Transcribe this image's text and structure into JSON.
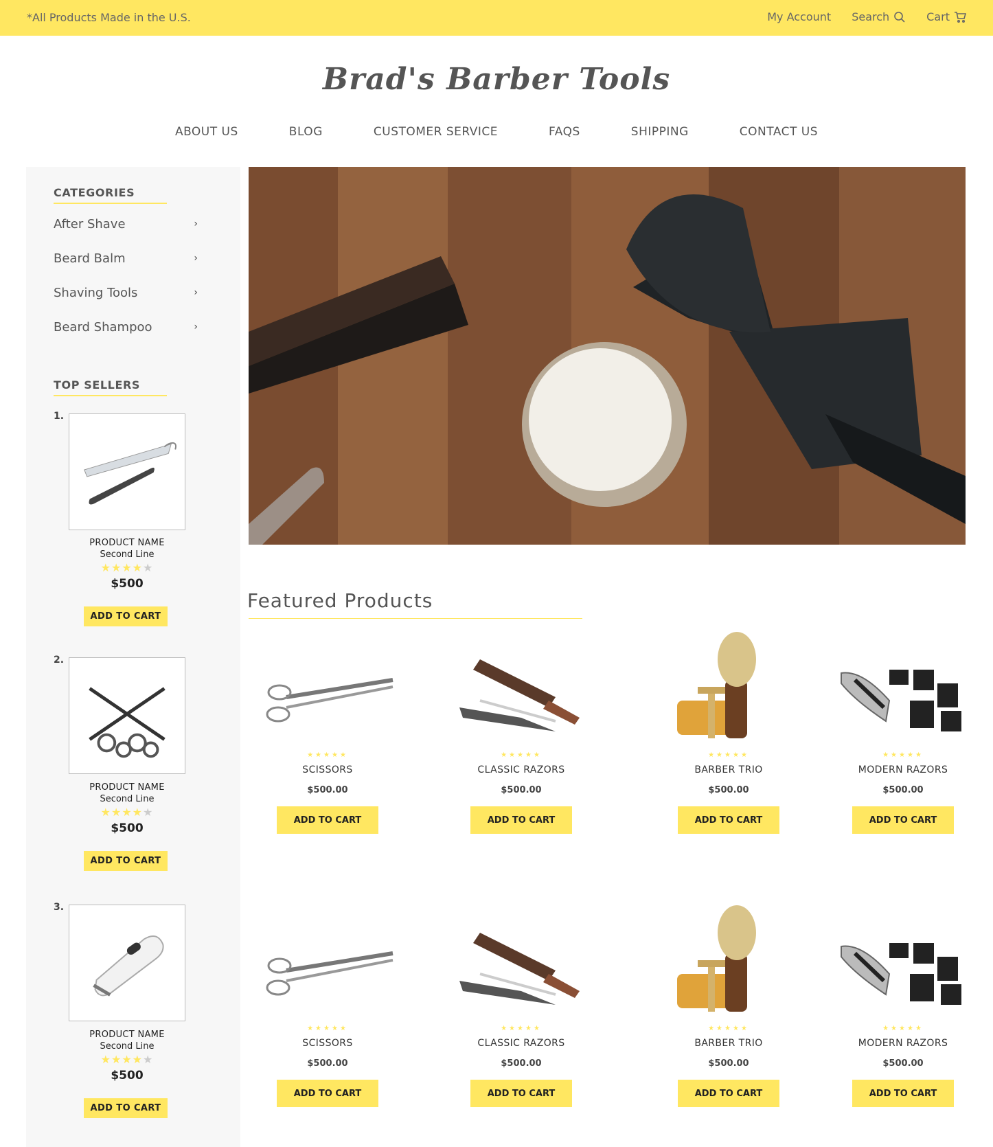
{
  "topbar": {
    "note": "*All Products Made in the U.S.",
    "my_account": "My Account",
    "search": "Search",
    "cart": "Cart"
  },
  "logo": "Brad's Barber Tools",
  "nav": [
    "ABOUT US",
    "BLOG",
    "CUSTOMER SERVICE",
    "FAQS",
    "SHIPPING",
    "CONTACT US"
  ],
  "sidebar": {
    "categories_heading": "CATEGORIES",
    "categories": [
      "After Shave",
      "Beard Balm",
      "Shaving Tools",
      "Beard Shampoo"
    ],
    "top_sellers_heading": "TOP SELLERS",
    "top_sellers": [
      {
        "rank": "1.",
        "name": "PRODUCT NAME",
        "line": "Second Line",
        "rating": 4,
        "price": "$500",
        "button": "ADD TO CART",
        "icon": "straight-razor"
      },
      {
        "rank": "2.",
        "name": "PRODUCT NAME",
        "line": "Second Line",
        "rating": 4,
        "price": "$500",
        "button": "ADD TO CART",
        "icon": "scissors"
      },
      {
        "rank": "3.",
        "name": "PRODUCT NAME",
        "line": "Second Line",
        "rating": 4,
        "price": "$500",
        "button": "ADD TO CART",
        "icon": "electric-shaver"
      }
    ]
  },
  "featured": {
    "title": "Featured Products",
    "products": [
      {
        "name": "SCISSORS",
        "price": "$500.00",
        "button": "ADD TO CART",
        "icon": "scissors"
      },
      {
        "name": "CLASSIC RAZORS",
        "price": "$500.00",
        "button": "ADD TO CART",
        "icon": "classic-razor"
      },
      {
        "name": "BARBER TRIO",
        "price": "$500.00",
        "button": "ADD TO CART",
        "icon": "barber-trio"
      },
      {
        "name": "MODERN RAZORS",
        "price": "$500.00",
        "button": "ADD TO CART",
        "icon": "clipper-set"
      },
      {
        "name": "SCISSORS",
        "price": "$500.00",
        "button": "ADD TO CART",
        "icon": "scissors"
      },
      {
        "name": "CLASSIC RAZORS",
        "price": "$500.00",
        "button": "ADD TO CART",
        "icon": "classic-razor"
      },
      {
        "name": "BARBER TRIO",
        "price": "$500.00",
        "button": "ADD TO CART",
        "icon": "barber-trio"
      },
      {
        "name": "MODERN RAZORS",
        "price": "$500.00",
        "button": "ADD TO CART",
        "icon": "clipper-set"
      }
    ]
  },
  "colors": {
    "accent": "#ffe761",
    "text": "#555555",
    "sidebar_bg": "#f7f7f7"
  }
}
